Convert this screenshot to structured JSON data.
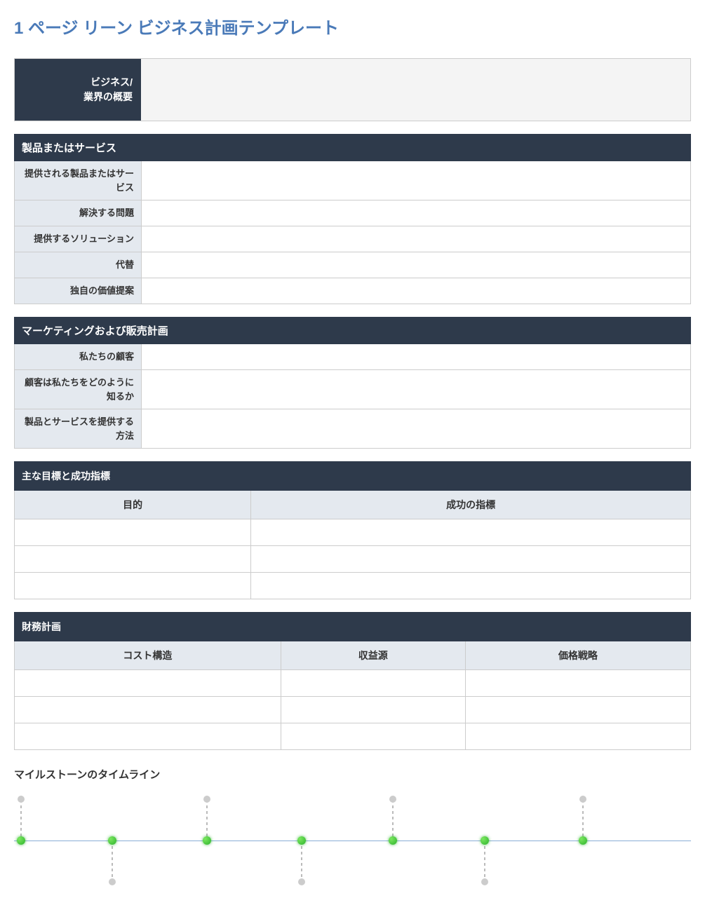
{
  "title": "1 ページ リーン ビジネス計画テンプレート",
  "overview": {
    "label": "ビジネス/\n業界の概要",
    "value": ""
  },
  "product_service": {
    "header": "製品またはサービス",
    "rows": [
      {
        "label": "提供される製品またはサービス",
        "value": ""
      },
      {
        "label": "解決する問題",
        "value": ""
      },
      {
        "label": "提供するソリューション",
        "value": ""
      },
      {
        "label": "代替",
        "value": ""
      },
      {
        "label": "独自の価値提案",
        "value": ""
      }
    ]
  },
  "marketing_sales": {
    "header": "マーケティングおよび販売計画",
    "rows": [
      {
        "label": "私たちの顧客",
        "value": ""
      },
      {
        "label": "顧客は私たちをどのように知るか",
        "value": ""
      },
      {
        "label": "製品とサービスを提供する方法",
        "value": ""
      }
    ]
  },
  "objectives": {
    "header": "主な目標と成功指標",
    "columns": [
      "目的",
      "成功の指標"
    ],
    "rows": [
      [
        "",
        ""
      ],
      [
        "",
        ""
      ],
      [
        "",
        ""
      ]
    ]
  },
  "financial": {
    "header": "財務計画",
    "columns": [
      "コスト構造",
      "収益源",
      "価格戦略"
    ],
    "rows": [
      [
        "",
        "",
        ""
      ],
      [
        "",
        "",
        ""
      ],
      [
        "",
        "",
        ""
      ]
    ]
  },
  "timeline": {
    "title": "マイルストーンのタイムライン",
    "milestones": [
      {
        "pos_pct": 1.0,
        "dir": "up"
      },
      {
        "pos_pct": 14.5,
        "dir": "down"
      },
      {
        "pos_pct": 28.5,
        "dir": "up"
      },
      {
        "pos_pct": 42.5,
        "dir": "down"
      },
      {
        "pos_pct": 56.0,
        "dir": "up"
      },
      {
        "pos_pct": 69.5,
        "dir": "down"
      },
      {
        "pos_pct": 84.0,
        "dir": "up"
      }
    ]
  }
}
